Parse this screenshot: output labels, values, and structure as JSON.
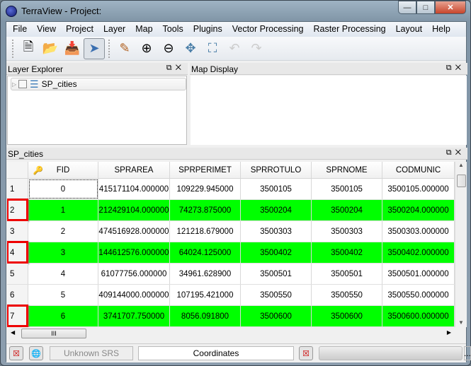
{
  "window": {
    "title": "TerraView - Project:"
  },
  "menu": [
    "File",
    "View",
    "Project",
    "Layer",
    "Map",
    "Tools",
    "Plugins",
    "Vector Processing",
    "Raster Processing",
    "Layout",
    "Help"
  ],
  "layer_explorer": {
    "title": "Layer Explorer",
    "layers": [
      {
        "name": "SP_cities",
        "checked": false
      }
    ]
  },
  "map_display": {
    "title": "Map Display"
  },
  "table": {
    "title": "SP_cities",
    "columns": [
      "",
      "FID",
      "SPRAREA",
      "SPRPERIMET",
      "SPRROTULO",
      "SPRNOME",
      "CODMUNIC"
    ],
    "rows": [
      {
        "n": "1",
        "cells": [
          "0",
          "415171104.000000",
          "109229.945000",
          "3500105",
          "3500105",
          "3500105.000000"
        ],
        "selected": false
      },
      {
        "n": "2",
        "cells": [
          "1",
          "212429104.000000",
          "74273.875000",
          "3500204",
          "3500204",
          "3500204.000000"
        ],
        "selected": true
      },
      {
        "n": "3",
        "cells": [
          "2",
          "474516928.000000",
          "121218.679000",
          "3500303",
          "3500303",
          "3500303.000000"
        ],
        "selected": false
      },
      {
        "n": "4",
        "cells": [
          "3",
          "144612576.000000",
          "64024.125000",
          "3500402",
          "3500402",
          "3500402.000000"
        ],
        "selected": true
      },
      {
        "n": "5",
        "cells": [
          "4",
          "61077756.000000",
          "34961.628900",
          "3500501",
          "3500501",
          "3500501.000000"
        ],
        "selected": false
      },
      {
        "n": "6",
        "cells": [
          "5",
          "409144000.000000",
          "107195.421000",
          "3500550",
          "3500550",
          "3500550.000000"
        ],
        "selected": false
      },
      {
        "n": "7",
        "cells": [
          "6",
          "3741707.750000",
          "8056.091800",
          "3500600",
          "3500600",
          "3500600.000000"
        ],
        "selected": true
      }
    ],
    "selection_color": "#00ff00",
    "annotation_color": "#e00000"
  },
  "status": {
    "srs": "Unknown SRS",
    "coordinates": "Coordinates",
    "more": "..."
  }
}
